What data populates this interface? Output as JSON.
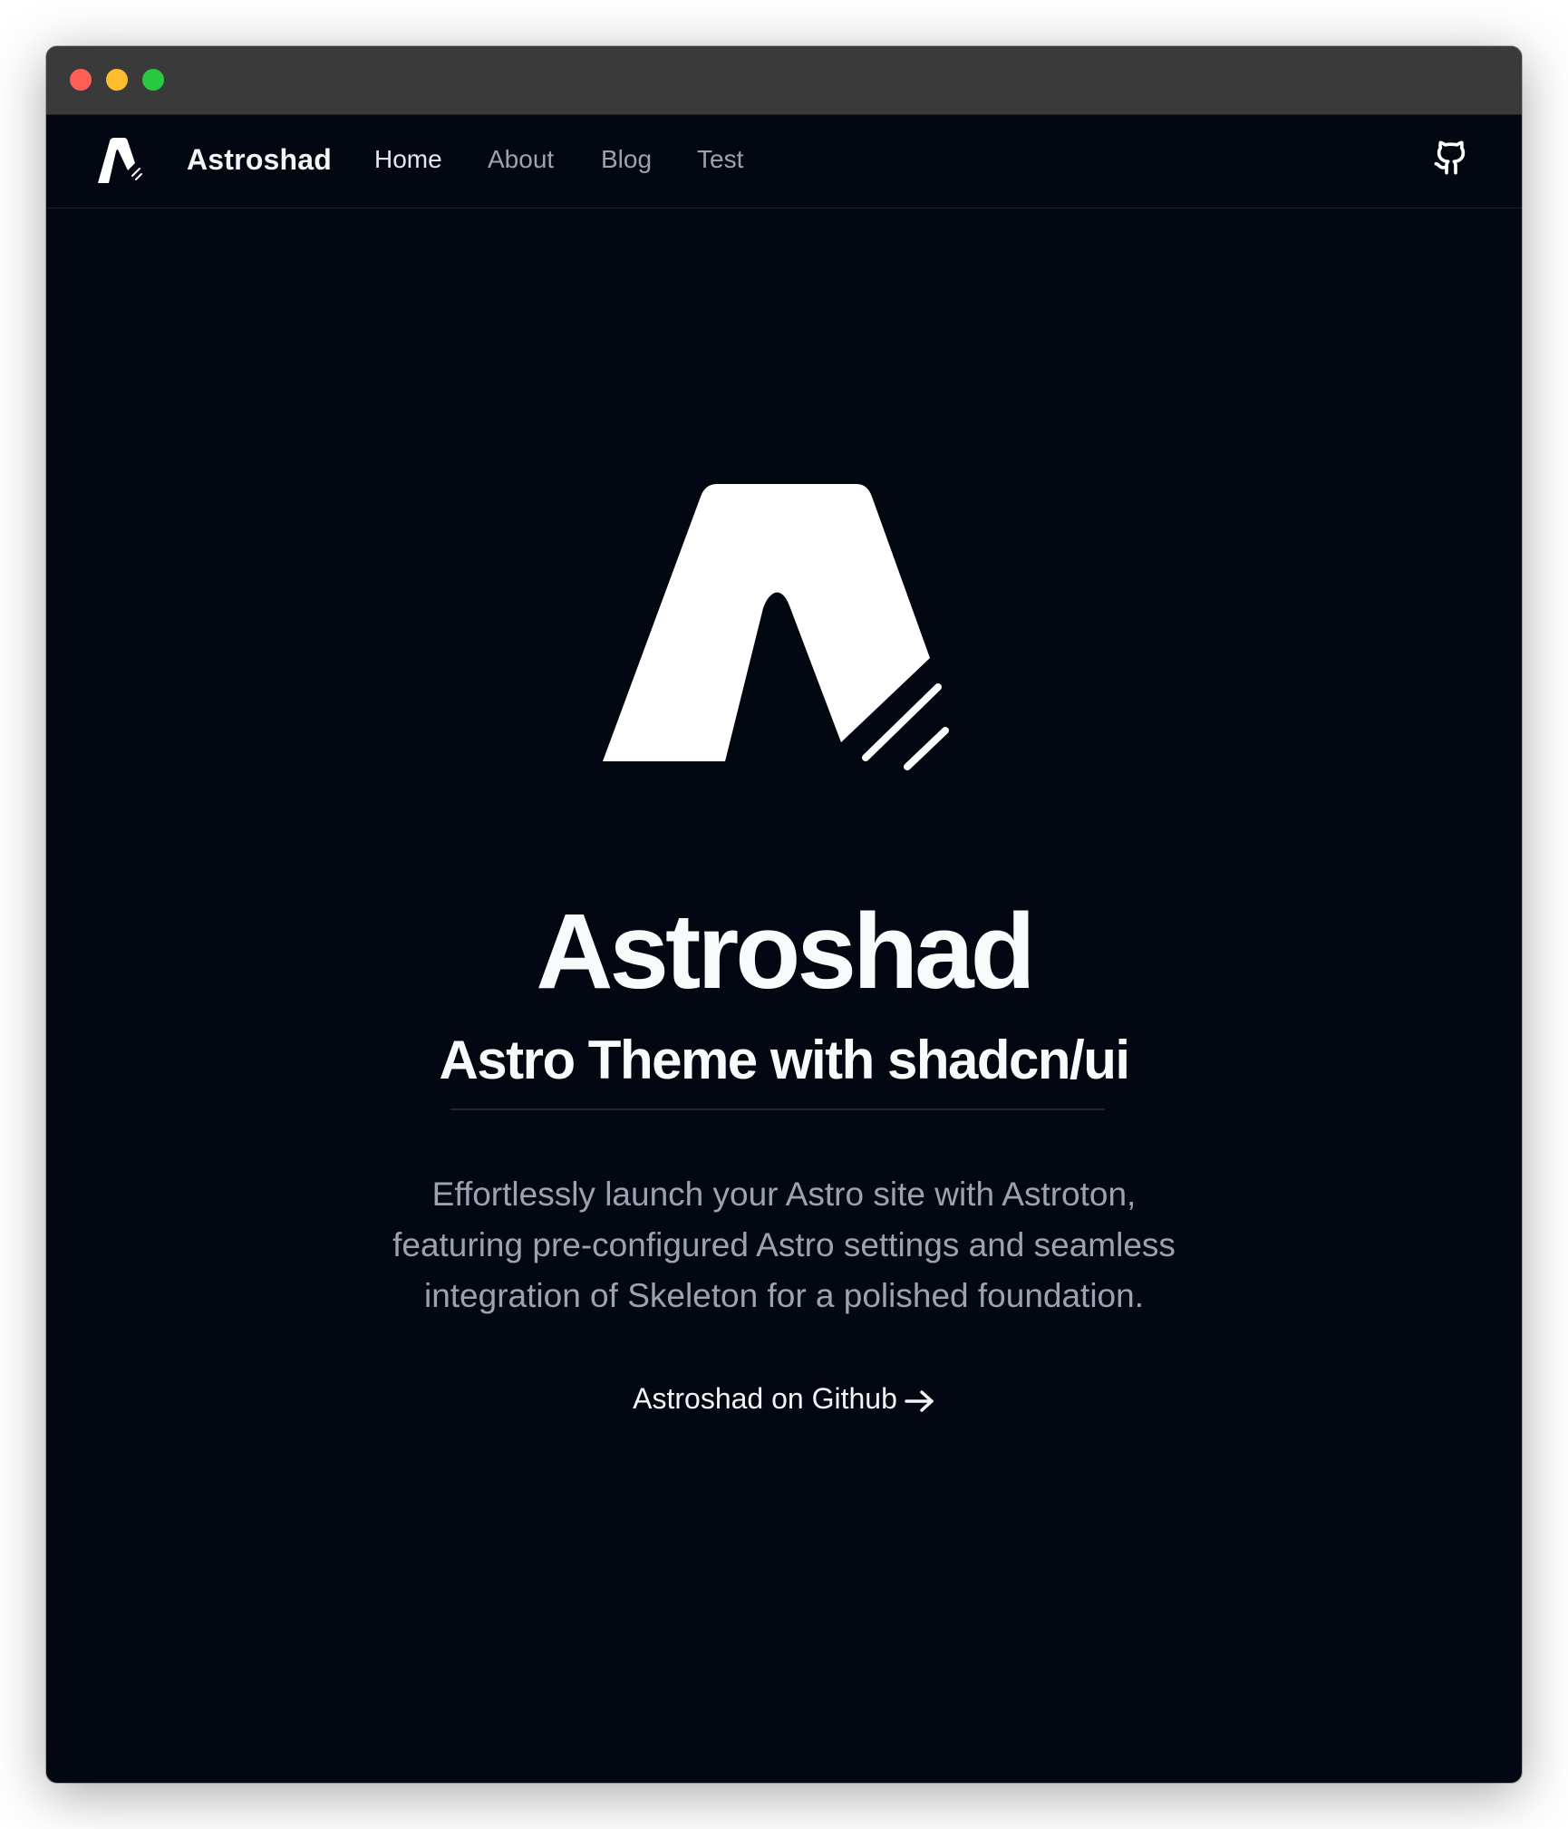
{
  "window": {
    "traffic_lights": {
      "close_color": "#fe5f57",
      "minimize_color": "#febc2e",
      "maximize_color": "#28c840"
    }
  },
  "navbar": {
    "logo_icon": "astroshad-logo-icon",
    "brand": "Astroshad",
    "links": [
      {
        "label": "Home"
      },
      {
        "label": "About"
      },
      {
        "label": "Blog"
      },
      {
        "label": "Test"
      }
    ],
    "github_icon": "github-icon"
  },
  "hero": {
    "logo_icon": "astroshad-logo-icon",
    "title": "Astroshad",
    "subtitle": "Astro Theme with shadcn/ui",
    "description_lines": [
      "Effortlessly launch your Astro site with Astroton,",
      "featuring pre-configured Astro settings and seamless",
      "integration of Skeleton for a polished foundation."
    ],
    "cta_label": "Astroshad on Github",
    "cta_icon": "arrow-right-icon"
  },
  "colors": {
    "background": "#030712",
    "foreground": "#f9fafb",
    "muted": "#9ca3af",
    "titlebar": "#3a3a3a"
  }
}
